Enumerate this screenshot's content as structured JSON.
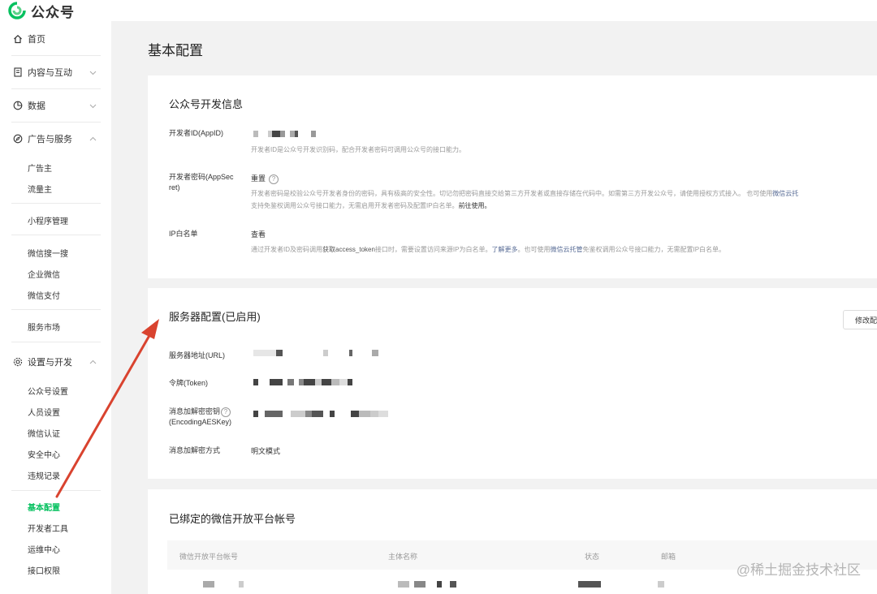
{
  "header": {
    "app_name": "公众号"
  },
  "sidebar": {
    "home": "首页",
    "content": "内容与互动",
    "data": "数据",
    "ads": "广告与服务",
    "ads_items": [
      "广告主",
      "流量主",
      "小程序管理",
      "微信搜一搜",
      "企业微信",
      "微信支付",
      "服务市场"
    ],
    "settings": "设置与开发",
    "settings_items": [
      "公众号设置",
      "人员设置",
      "微信认证",
      "安全中心",
      "违规记录",
      "基本配置",
      "开发者工具",
      "运维中心",
      "接口权限"
    ]
  },
  "page": {
    "title": "基本配置"
  },
  "dev_info": {
    "title": "公众号开发信息",
    "appid_label": "开发者ID(AppID)",
    "appid_desc": "开发者ID是公众号开发识别码，配合开发者密码可调用公众号的接口能力。",
    "secret_label_1": "开发者密码(AppSec",
    "secret_label_2": "ret)",
    "secret_action": "重置",
    "secret_desc_1": "开发者密码是校验公众号开发者身份的密码，具有极高的安全性。切记勿把密码直接交给第三方开发者或直接存储在代码中。如需第三方开发公众号，请使用授权方式接入。 也可使用",
    "secret_desc_link": "微信云托",
    "secret_desc_2": "支持免鉴权调用公众号接口能力，无需启用开发者密码及配置IP白名单。",
    "secret_desc_link2": "前往使用。",
    "ip_label": "IP白名单",
    "ip_action": "查看",
    "ip_desc_1": "通过开发者ID及密码调用",
    "ip_desc_strong": "获取access_token",
    "ip_desc_2": "接口时，需要设置访问来源IP为白名单。",
    "ip_desc_link": "了解更多",
    "ip_desc_3": "。也可使用",
    "ip_desc_link2": "微信云托管",
    "ip_desc_4": "免鉴权调用公众号接口能力，无需配置IP白名单。"
  },
  "server": {
    "title": "服务器配置(已启用)",
    "modify_button": "修改配",
    "url_label": "服务器地址(URL)",
    "token_label": "令牌(Token)",
    "aes_label_1": "消息加解密密钥",
    "aes_label_2": "(EncodingAESKey)",
    "mode_label": "消息加解密方式",
    "mode_value": "明文模式"
  },
  "bound": {
    "title": "已绑定的微信开放平台帐号",
    "columns": [
      "微信开放平台帐号",
      "主体名称",
      "状态",
      "邮箱"
    ]
  },
  "watermark": "@稀土掘金技术社区",
  "colors": {
    "accent": "#07c160",
    "link": "#576b95",
    "annotation_arrow": "#d9432f"
  }
}
